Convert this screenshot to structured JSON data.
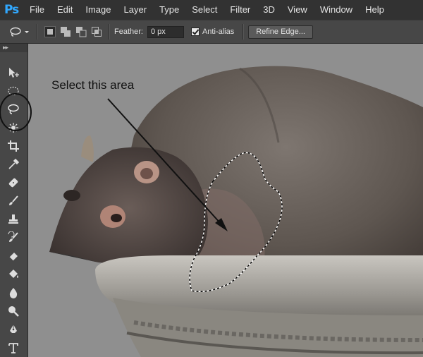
{
  "app": {
    "logo": "Ps"
  },
  "menu": [
    "File",
    "Edit",
    "Image",
    "Layer",
    "Type",
    "Select",
    "Filter",
    "3D",
    "View",
    "Window",
    "Help"
  ],
  "options": {
    "feather_label": "Feather:",
    "feather_value": "0 px",
    "antialias_label": "Anti-alias",
    "antialias_checked": true,
    "refine_label": "Refine Edge..."
  },
  "tools": [
    "move-tool",
    "marquee-tool",
    "lasso-tool",
    "quick-selection-tool",
    "crop-tool",
    "eyedropper-tool",
    "spot-healing-tool",
    "brush-tool",
    "clone-stamp-tool",
    "history-brush-tool",
    "eraser-tool",
    "paint-bucket-tool",
    "blur-tool",
    "dodge-tool",
    "pen-tool",
    "type-tool"
  ],
  "active_tool": "lasso-tool",
  "annotation": {
    "text": "Select this area"
  },
  "colors": {
    "menubar": "#323232",
    "panel": "#474747",
    "canvas": "#8f8f8f",
    "accent": "#31a8ff"
  }
}
